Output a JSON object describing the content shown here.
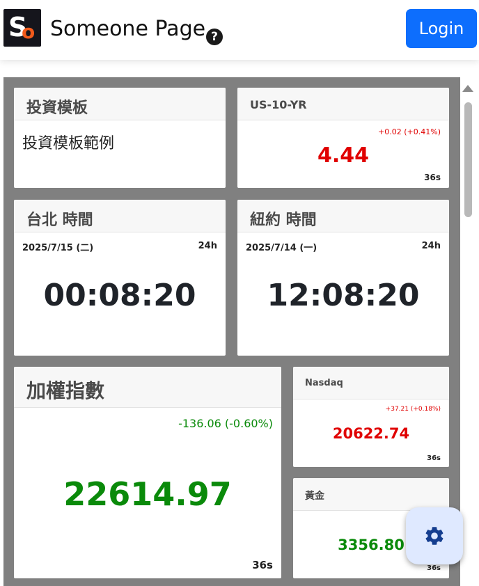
{
  "header": {
    "logo_text_s": "S",
    "logo_text_o": "o",
    "title": "Someone Page",
    "help_icon": "question-circle-icon",
    "login_label": "Login"
  },
  "colors": {
    "accent": "#0d6efd",
    "up": "#e00000",
    "down": "#0a8a0a",
    "board_bg": "#808080",
    "logo_orange": "#f25a1b"
  },
  "cards": {
    "template": {
      "title": "投資模板",
      "body": "投資模板範例"
    },
    "us10yr": {
      "title": "US-10-YR",
      "change": "+0.02 (+0.41%)",
      "value": "4.44",
      "age": "36s"
    },
    "taipei_time": {
      "title": "台北 時間",
      "date": "2025/7/15 (二)",
      "format": "24h",
      "time": "00:08:20"
    },
    "newyork_time": {
      "title": "紐約 時間",
      "date": "2025/7/14 (一)",
      "format": "24h",
      "time": "12:08:20"
    },
    "taiex": {
      "title": "加權指數",
      "change": "-136.06 (-0.60%)",
      "value": "22614.97",
      "age": "36s"
    },
    "nasdaq": {
      "title": "Nasdaq",
      "change": "+37.21 (+0.18%)",
      "value": "20622.74",
      "age": "36s"
    },
    "gold": {
      "title": "黃金",
      "value": "3356.80",
      "age": "36s"
    }
  },
  "fab": {
    "icon": "gear-icon"
  }
}
